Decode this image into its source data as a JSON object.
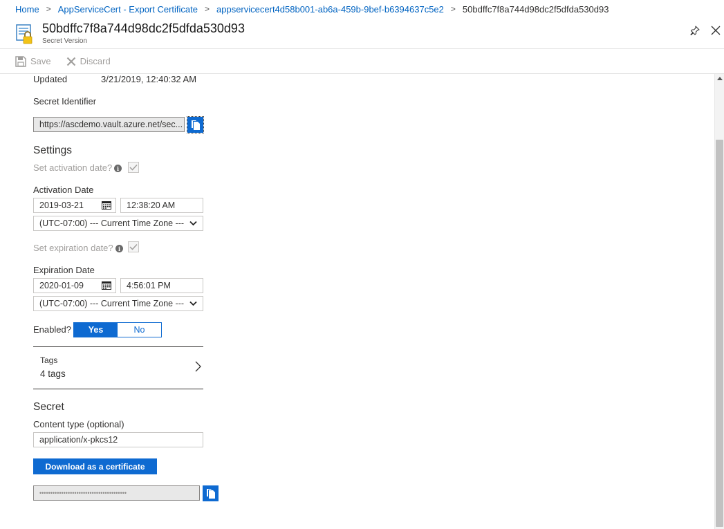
{
  "breadcrumb": {
    "items": [
      "Home",
      "AppServiceCert - Export Certificate",
      "appservicecert4d58b001-ab6a-459b-9bef-b6394637c5e2"
    ],
    "current": "50bdffc7f8a744d98dc2f5dfda530d93"
  },
  "blade": {
    "title": "50bdffc7f8a744d98dc2f5dfda530d93",
    "subtitle": "Secret Version"
  },
  "toolbar": {
    "save_label": "Save",
    "discard_label": "Discard"
  },
  "details": {
    "updated_label": "Updated",
    "updated_value": "3/21/2019, 12:40:32 AM",
    "secret_identifier_label": "Secret Identifier",
    "secret_identifier_value": "https://ascdemo.vault.azure.net/sec..."
  },
  "settings": {
    "heading": "Settings",
    "set_activation_label": "Set activation date?",
    "set_activation_checked": true,
    "activation_date_label": "Activation Date",
    "activation_date": "2019-03-21",
    "activation_time": "12:38:20 AM",
    "activation_timezone": "(UTC-07:00) --- Current Time Zone ---",
    "set_expiration_label": "Set expiration date?",
    "set_expiration_checked": true,
    "expiration_date_label": "Expiration Date",
    "expiration_date": "2020-01-09",
    "expiration_time": "4:56:01 PM",
    "expiration_timezone": "(UTC-07:00) --- Current Time Zone ---",
    "enabled_label": "Enabled?",
    "enabled_yes": "Yes",
    "enabled_no": "No",
    "enabled_value": "Yes"
  },
  "tags": {
    "label": "Tags",
    "value": "4 tags"
  },
  "secret": {
    "heading": "Secret",
    "content_type_label": "Content type (optional)",
    "content_type_value": "application/x-pkcs12",
    "download_label": "Download as a certificate",
    "masked_value": "••••••••••••••••••••••••••••••••••••••••"
  },
  "colors": {
    "accent": "#0e6ad1",
    "link": "#0063c1",
    "disabled": "#a19f9d"
  }
}
